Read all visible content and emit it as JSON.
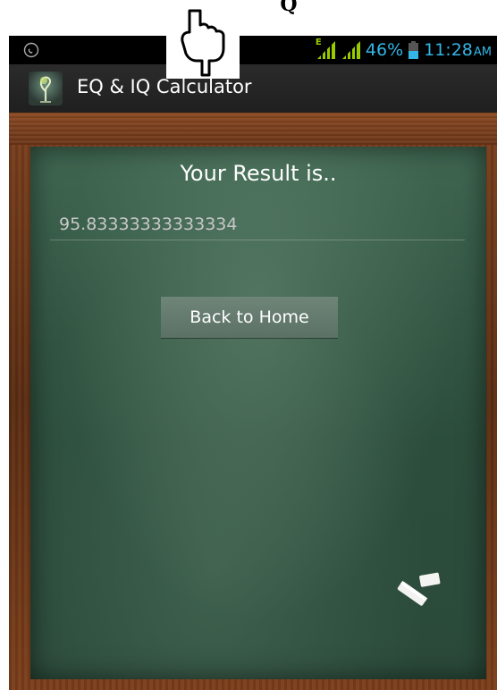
{
  "top_title": "Q",
  "status_bar": {
    "battery_percent": "46%",
    "time": "11:28",
    "ampm": "AM",
    "network_type": "E",
    "icons": [
      "call-icon",
      "signal-icon",
      "battery-icon"
    ]
  },
  "action_bar": {
    "app_icon": "tree-icon",
    "title": "EQ & IQ Calculator"
  },
  "main": {
    "result_title": "Your Result is..",
    "result_value": "95.83333333333334",
    "home_button_label": "Back to Home"
  },
  "decorations": {
    "pointer": "pointing-hand-icon",
    "chalk": "chalk-icon"
  },
  "colors": {
    "status_text": "#33b5e5",
    "signal_green": "#99cc00",
    "board_green": "#2c4d3c",
    "frame_brown": "#6a3418"
  }
}
